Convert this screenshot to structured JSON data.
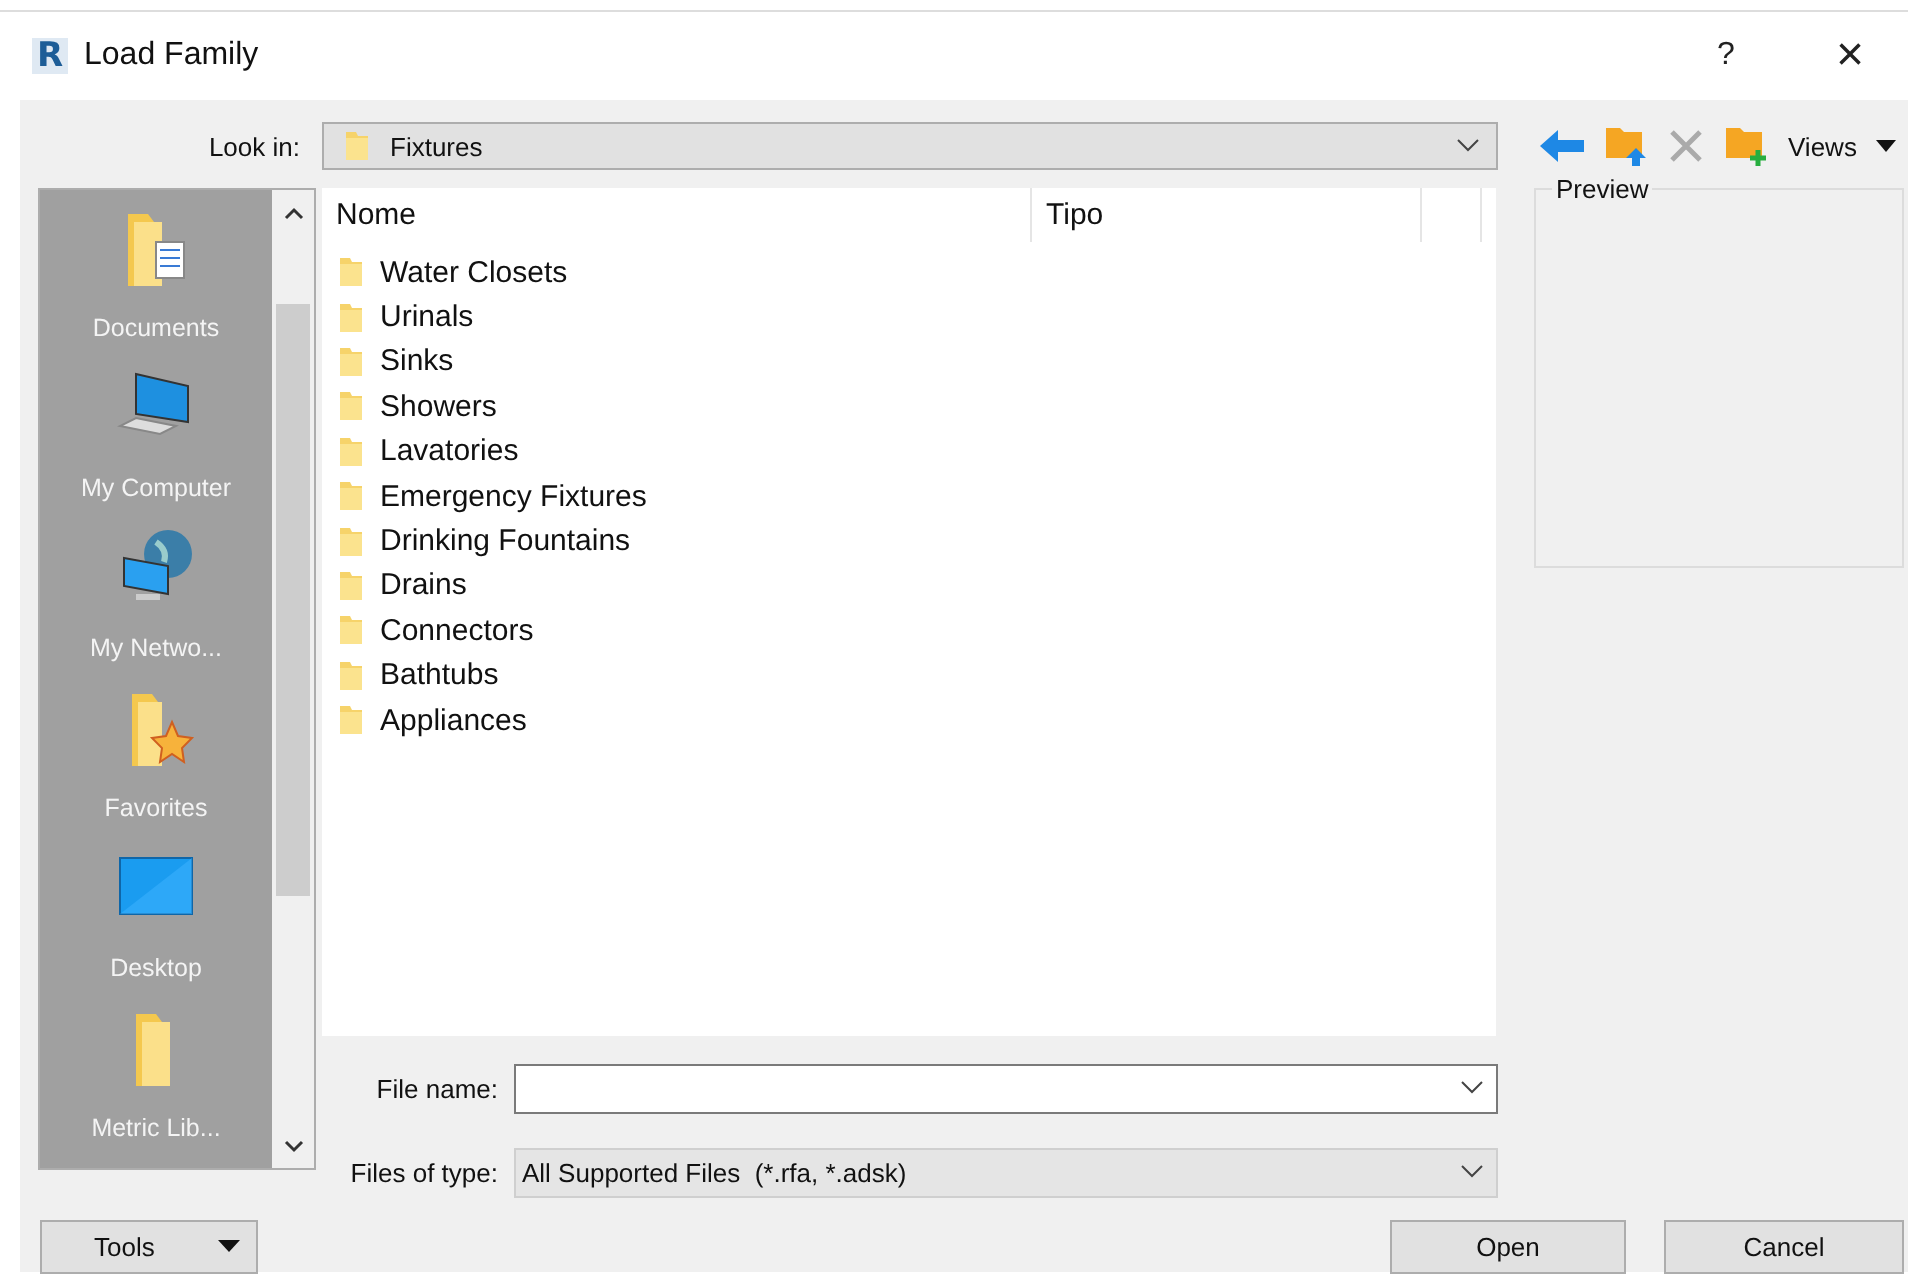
{
  "window": {
    "logo": "R",
    "title": "Load Family",
    "help": "?",
    "close": "×"
  },
  "look_in": {
    "label": "Look in:",
    "value": "Fixtures"
  },
  "toolbar": {
    "views": "Views"
  },
  "places": [
    {
      "label": "Documents",
      "kind": "documents"
    },
    {
      "label": "My Computer",
      "kind": "computer"
    },
    {
      "label": "My Netwo...",
      "kind": "network"
    },
    {
      "label": "Favorites",
      "kind": "favorites"
    },
    {
      "label": "Desktop",
      "kind": "desktop"
    },
    {
      "label": "Metric Lib...",
      "kind": "folder"
    }
  ],
  "table": {
    "columns": [
      "Nome",
      "Tipo"
    ],
    "rows": [
      "Water Closets",
      "Urinals",
      "Sinks",
      "Showers",
      "Lavatories",
      "Emergency Fixtures",
      "Drinking Fountains",
      "Drains",
      "Connectors",
      "Bathtubs",
      "Appliances"
    ]
  },
  "preview": {
    "label": "Preview"
  },
  "file_name": {
    "label": "File name:"
  },
  "file_type": {
    "label": "Files of type:",
    "value": "All Supported Files  (*.rfa, *.adsk)"
  },
  "buttons": {
    "tools": "Tools",
    "open": "Open",
    "cancel": "Cancel"
  }
}
